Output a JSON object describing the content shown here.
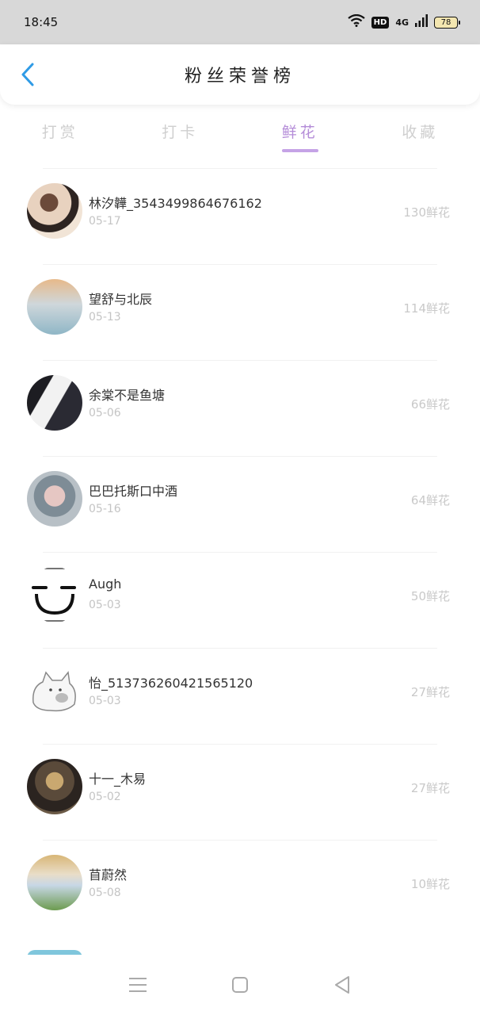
{
  "status": {
    "time": "18:45",
    "hd": "HD",
    "network": "4G",
    "battery": "78"
  },
  "header": {
    "title": "粉丝荣誉榜"
  },
  "tabs": [
    {
      "label": "打赏"
    },
    {
      "label": "打卡"
    },
    {
      "label": "鲜花",
      "active": true
    },
    {
      "label": "收藏"
    }
  ],
  "fans": [
    {
      "name": "林汐韡_3543499864676162",
      "date": "05-17",
      "count": "130鲜花"
    },
    {
      "name": "望舒与北辰",
      "date": "05-13",
      "count": "114鲜花"
    },
    {
      "name": "余棠不是鱼塘",
      "date": "05-06",
      "count": "66鲜花"
    },
    {
      "name": "巴巴托斯口中酒",
      "date": "05-16",
      "count": "64鲜花"
    },
    {
      "name": "Augh",
      "date": "05-03",
      "count": "50鲜花"
    },
    {
      "name": "怡_513736260421565120",
      "date": "05-03",
      "count": "27鲜花"
    },
    {
      "name": "十一_木易",
      "date": "05-02",
      "count": "27鲜花"
    },
    {
      "name": "苜蔚然",
      "date": "05-08",
      "count": "10鲜花"
    }
  ],
  "colors": {
    "accent": "#b48cd8",
    "back": "#2f9be6"
  }
}
